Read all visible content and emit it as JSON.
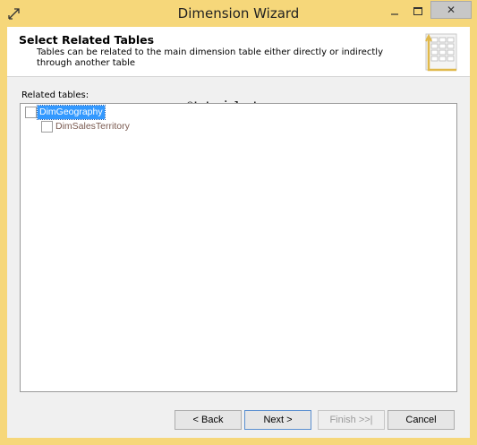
{
  "window": {
    "title": "Dimension Wizard",
    "close_glyph": "✕",
    "icons": {
      "app": "wizard-app-icon",
      "minimize": "minimize-icon",
      "maximize": "maximize-icon",
      "close": "close-icon",
      "header": "related-tables-graphic-icon"
    }
  },
  "header": {
    "title": "Select Related Tables",
    "description": "Tables can be related to the main dimension table either directly or indirectly through another table"
  },
  "tree": {
    "label": "Related tables:",
    "items": [
      {
        "label": "DimGeography",
        "checked": false,
        "selected": true
      },
      {
        "label": "DimSalesTerritory",
        "checked": false,
        "selected": false
      }
    ]
  },
  "watermark": "©tutorialgateway.org",
  "buttons": {
    "back": "< Back",
    "next": "Next >",
    "finish": "Finish >>|",
    "cancel": "Cancel"
  },
  "colors": {
    "frame": "#f6d77a",
    "selection": "#3399ff",
    "disabled_text": "#9a9a9a"
  }
}
